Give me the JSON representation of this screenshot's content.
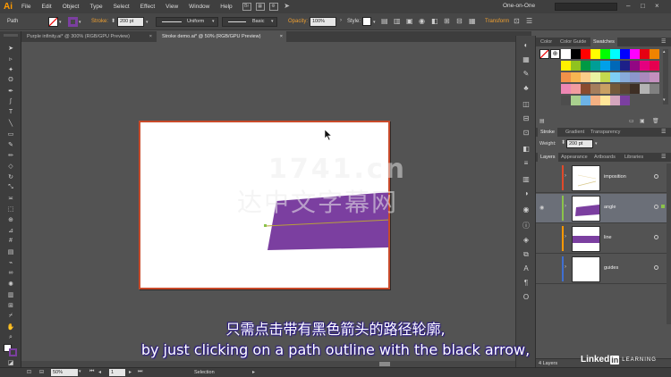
{
  "app": {
    "logo": "Ai",
    "menu": [
      "File",
      "Edit",
      "Object",
      "Type",
      "Select",
      "Effect",
      "View",
      "Window",
      "Help"
    ],
    "workspace": "One-on-One",
    "window_controls": [
      "–",
      "□",
      "×"
    ]
  },
  "control_bar": {
    "selection": "Path",
    "stroke_label": "Stroke:",
    "stroke_value": "200 pt",
    "profile": "Uniform",
    "brush": "Basic",
    "opacity_label": "Opacity:",
    "opacity_value": "100%",
    "style_label": "Style:",
    "transform_label": "Transform",
    "fill_color": "#ffffff",
    "stroke_color": "#7b3fa0"
  },
  "documents": {
    "tabs": [
      {
        "label": "Purple infinity.ai* @ 300% (RGB/GPU Preview)",
        "close": "×",
        "active": false
      },
      {
        "label": "Stroke demo.ai* @ 50% (RGB/GPU Preview)",
        "close": "×",
        "active": true
      }
    ]
  },
  "tools": [
    "selection-arrow",
    "direct-selection",
    "magic-wand",
    "lasso",
    "pen",
    "curvature",
    "type",
    "line",
    "rectangle",
    "paintbrush",
    "pencil",
    "eraser",
    "rotate",
    "scale",
    "width",
    "free-transform",
    "shape-builder",
    "perspective",
    "mesh",
    "gradient",
    "eyedropper",
    "blend",
    "symbol-sprayer",
    "column-graph",
    "artboard",
    "slice",
    "hand",
    "zoom"
  ],
  "color_panel": {
    "tabs": [
      "Color",
      "Color Guide",
      "Swatches"
    ],
    "active_tab": "Swatches",
    "swatch_rows": [
      [
        "#ffffff",
        "#000000",
        "#ff0000",
        "#ffff00",
        "#00ff00",
        "#00ffff",
        "#0000ff",
        "#ff00ff",
        "#e60012",
        "#f08300"
      ],
      [
        "#fff100",
        "#8fc31f",
        "#009944",
        "#009e96",
        "#00a0e9",
        "#0068b7",
        "#1d2088",
        "#920783",
        "#e4007f",
        "#e5004f"
      ],
      [
        "#f19149",
        "#f8b551",
        "#facd89",
        "#e9f3a2",
        "#c3d94e",
        "#7ecef4",
        "#88abda",
        "#8c97cb",
        "#aa89bd",
        "#c490bf"
      ],
      [
        "#ee87b4",
        "#f29c9f",
        "#8a4b2f",
        "#a57e5d",
        "#c9a063",
        "#745a3b",
        "#594432",
        "#3e2f25",
        "#b3b3b3",
        "#808080"
      ],
      [
        "#4d4d4d",
        "#a9d08e",
        "#6db3e6",
        "#f4b183",
        "#ffe699",
        "#d5a6bd",
        "#7b3fa0"
      ]
    ]
  },
  "stroke_panel": {
    "tabs": [
      "Stroke",
      "Gradient",
      "Transparency"
    ],
    "weight_label": "Weight:",
    "weight_value": "200 pt"
  },
  "layers_panel": {
    "tabs": [
      "Layers",
      "Appearance",
      "Artboards",
      "Libraries"
    ],
    "layers": [
      {
        "name": "imposition",
        "color": "#e04a2a",
        "visible": false,
        "selected": false
      },
      {
        "name": "angle",
        "color": "#8bc34a",
        "visible": true,
        "selected": true
      },
      {
        "name": "line",
        "color": "#ff9800",
        "visible": false,
        "selected": false
      },
      {
        "name": "guides",
        "color": "#3f6fd1",
        "visible": false,
        "selected": false
      }
    ],
    "footer": "4 Layers"
  },
  "status": {
    "zoom": "50%",
    "artboard": "1",
    "tool": "Selection"
  },
  "subtitles": {
    "chinese": "只需点击带有黑色箭头的路径轮廓,",
    "english": "by just clicking on a path outline with the black arrow,"
  },
  "watermark": {
    "url": "1741.cn",
    "chinese": "达中文字幕网"
  },
  "branding": {
    "linked": "Linked",
    "in": "in",
    "learning": "LEARNING"
  }
}
